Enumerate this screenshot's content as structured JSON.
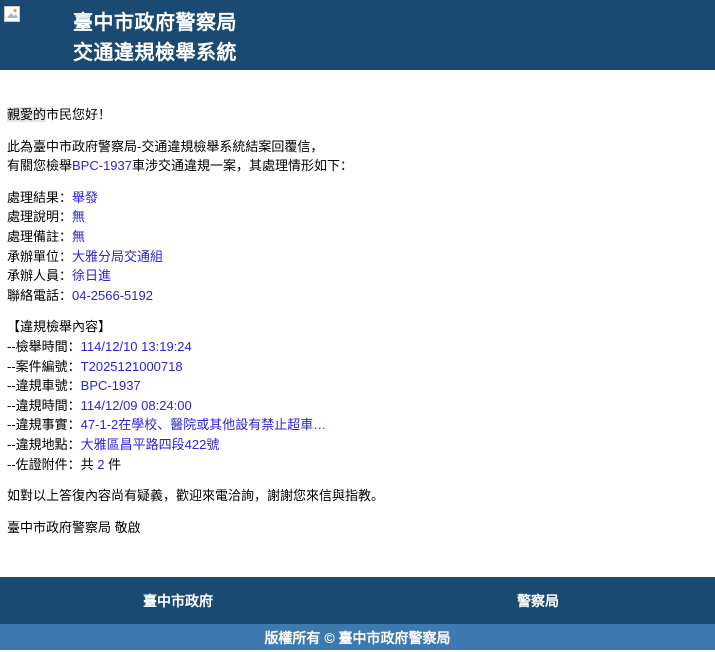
{
  "header": {
    "org": "臺中市政府警察局",
    "system": "交通違規檢舉系統"
  },
  "greeting": {
    "highlighted": "親愛的",
    "rest": "市民您好！"
  },
  "intro": {
    "line1": "此為臺中市政府警察局-交通違規檢舉系統結案回覆信，",
    "line2_prefix": "有關您檢舉",
    "plate": "BPC-1937",
    "line2_suffix": "車涉交通違規一案，其處理情形如下："
  },
  "processing": [
    {
      "label": "處理結果：",
      "value": "舉發"
    },
    {
      "label": "處理說明：",
      "value": "無"
    },
    {
      "label": "處理備註：",
      "value": "無"
    },
    {
      "label": "承辦單位：",
      "value": "大雅分局交通組"
    },
    {
      "label": "承辦人員：",
      "value": "徐日進"
    },
    {
      "label": "聯絡電話：",
      "value": "04-2566-5192"
    }
  ],
  "report": {
    "heading": "【違規檢舉內容】",
    "items": [
      {
        "label": "--檢舉時間：",
        "value": "114/12/10 13:19:24"
      },
      {
        "label": "--案件編號：",
        "value": "T2025121000718"
      },
      {
        "label": "--違規車號：",
        "value": "BPC-1937"
      },
      {
        "label": "--違規時間：",
        "value": "114/12/09 08:24:00"
      },
      {
        "label": "--違規事實：",
        "value": "47-1-2在學校、醫院或其他設有禁止超車…"
      },
      {
        "label": "--違規地點：",
        "value": "大雅區昌平路四段422號"
      }
    ],
    "attachments": {
      "label": "--佐證附件：",
      "prefix": "共 ",
      "count": "2",
      "suffix": " 件"
    }
  },
  "closing": "如對以上答復內容尚有疑義，歡迎來電洽詢，謝謝您來信與指教。",
  "signature": "臺中市政府警察局 敬啟",
  "footer": {
    "link1": "臺中市政府",
    "link2": "警察局",
    "copyright": "版權所有 © 臺中市政府警察局"
  },
  "colors": {
    "header_bg": "#1a4a72",
    "footer_copy_bg": "#3e7ab0",
    "value_text": "#2e24d6"
  },
  "icons": {
    "logo": "broken-image-icon"
  }
}
